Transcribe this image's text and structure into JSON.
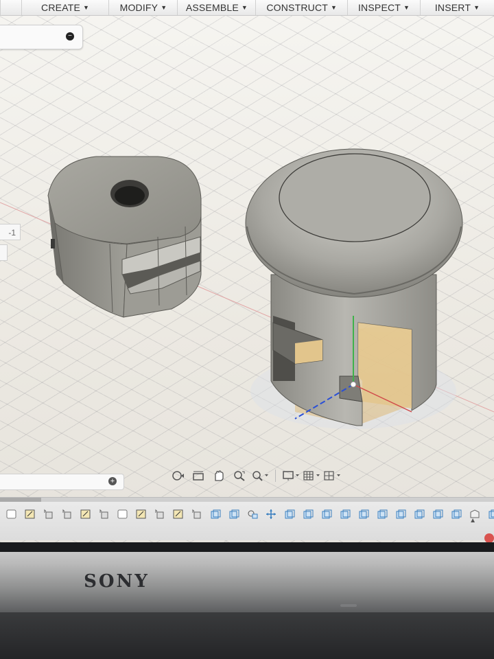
{
  "menubar": {
    "items": [
      {
        "label": "CREATE"
      },
      {
        "label": "MODIFY"
      },
      {
        "label": "ASSEMBLE"
      },
      {
        "label": "CONSTRUCT"
      },
      {
        "label": "INSPECT"
      },
      {
        "label": "INSERT"
      }
    ]
  },
  "side_tag": {
    "label": "-1"
  },
  "laptop": {
    "brand": "SONY"
  },
  "colors": {
    "model_body": "#8f8f88",
    "model_highlight": "#c9c8c1",
    "section_plane": "#e7c98e",
    "axis_red": "#d04a4a",
    "axis_green": "#3fb24a",
    "axis_blue": "#2a4fd6"
  },
  "icons": {
    "nav": [
      "orbit-icon",
      "look-at-icon",
      "pan-icon",
      "zoom-window-icon",
      "zoom-icon",
      "display-settings-icon",
      "grid-settings-icon",
      "viewports-icon"
    ],
    "timeline": [
      "sketch-feature-icon",
      "extrude-feature-icon",
      "revolve-feature-icon",
      "sweep-feature-icon",
      "split-body-icon",
      "move-feature-icon",
      "joint-feature-icon",
      "component-feature-icon"
    ]
  }
}
